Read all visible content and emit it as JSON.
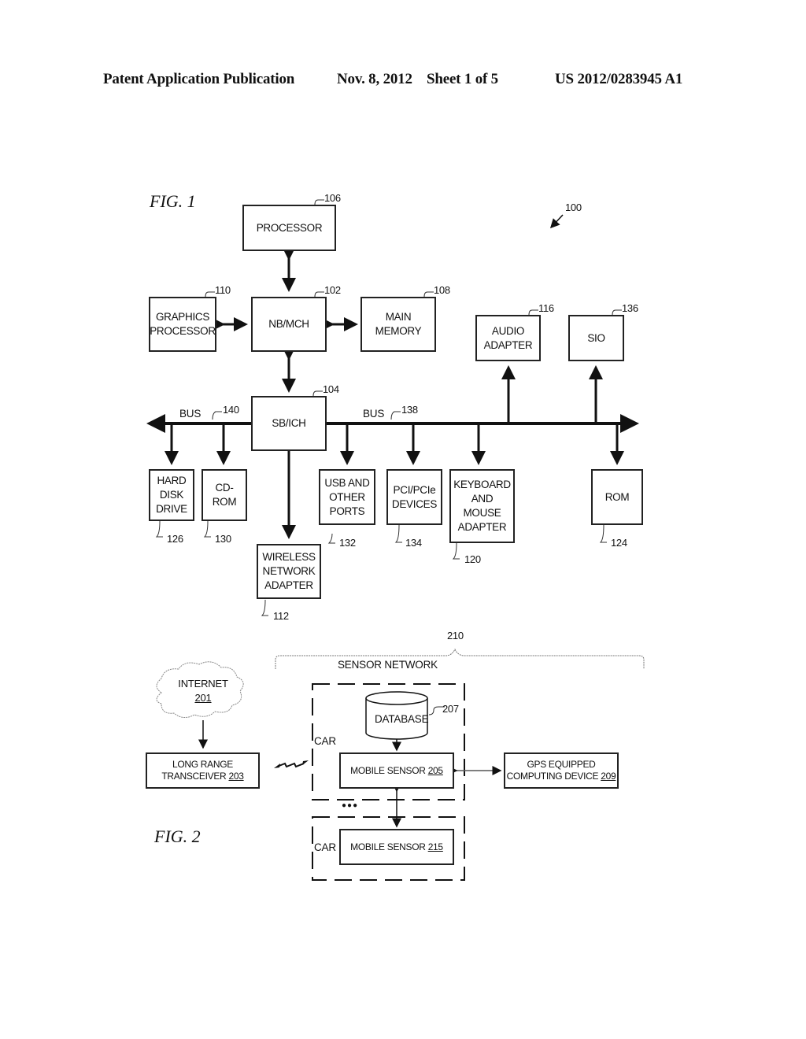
{
  "header": {
    "left": "Patent Application Publication",
    "middle": "Nov. 8, 2012    Sheet 1 of 5",
    "right": "US 2012/0283945 A1"
  },
  "fig1": {
    "title": "FIG. 1",
    "system_ref": "100",
    "boxes": {
      "processor": {
        "label": "PROCESSOR",
        "ref": "106"
      },
      "nb_mch": {
        "label": "NB/MCH",
        "ref": "102"
      },
      "graphics": {
        "label": "GRAPHICS\nPROCESSOR",
        "ref": "110"
      },
      "main_memory": {
        "label": "MAIN\nMEMORY",
        "ref": "108"
      },
      "audio": {
        "label": "AUDIO\nADAPTER",
        "ref": "116"
      },
      "sio": {
        "label": "SIO",
        "ref": "136"
      },
      "sb_ich": {
        "label": "SB/ICH",
        "ref": "104"
      },
      "hdd": {
        "label": "HARD\nDISK\nDRIVE",
        "ref": "126"
      },
      "cdrom": {
        "label": "CD-\nROM",
        "ref": "130"
      },
      "usb": {
        "label": "USB AND\nOTHER\nPORTS",
        "ref": "132"
      },
      "pci": {
        "label": "PCI/PCIe\nDEVICES",
        "ref": "134"
      },
      "keyboard": {
        "label": "KEYBOARD\nAND\nMOUSE\nADAPTER",
        "ref": "120"
      },
      "rom": {
        "label": "ROM",
        "ref": "124"
      },
      "wireless": {
        "label": "WIRELESS\nNETWORK\nADAPTER",
        "ref": "112"
      }
    },
    "buses": {
      "left": {
        "label": "BUS",
        "ref": "140"
      },
      "right": {
        "label": "BUS",
        "ref": "138"
      }
    }
  },
  "fig2": {
    "title": "FIG. 2",
    "network_ref": "210",
    "network_label": "SENSOR NETWORK",
    "internet": {
      "label": "INTERNET",
      "ref": "201"
    },
    "transceiver": {
      "label": "LONG RANGE\nTRANSCEIVER",
      "ref": "203"
    },
    "database": {
      "label": "DATABASE",
      "ref": "207"
    },
    "mobile_sensor_1": {
      "label": "MOBILE SENSOR",
      "ref": "205"
    },
    "mobile_sensor_2": {
      "label": "MOBILE SENSOR",
      "ref": "215"
    },
    "gps": {
      "label": "GPS EQUIPPED\nCOMPUTING DEVICE",
      "ref": "209"
    },
    "car_label": "CAR",
    "ellipsis": "●●●"
  }
}
